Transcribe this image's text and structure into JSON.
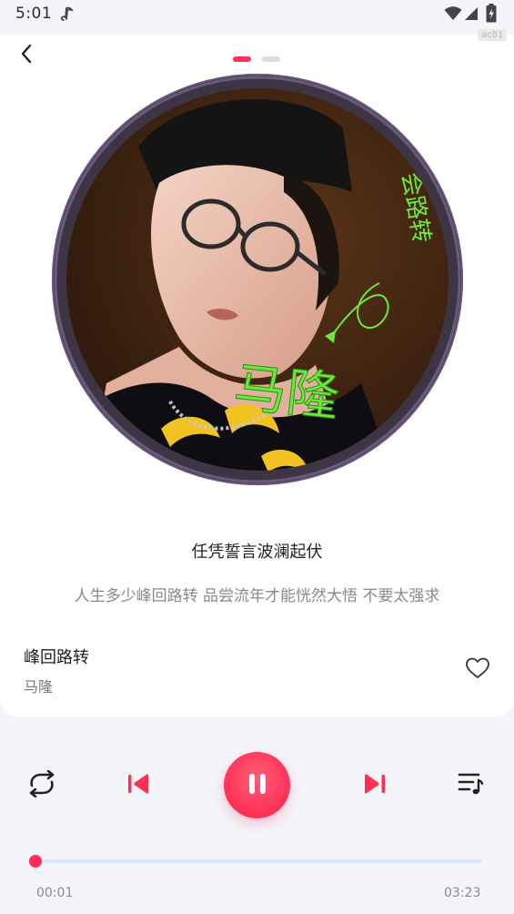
{
  "status_bar": {
    "time": "5:01",
    "app_icon": "music-note-icon",
    "wifi_icon": "wifi-icon",
    "signal_icon": "cell-signal-icon",
    "battery_icon": "battery-charging-icon"
  },
  "header": {
    "back_icon": "chevron-left-icon",
    "debug_badge": "ac81",
    "pages": 2,
    "active_page": 0
  },
  "album": {
    "cover_text": "马隆",
    "cover_text_secondary": "会路转"
  },
  "lyrics": {
    "current": "任凭誓言波澜起伏",
    "next": "人生多少峰回路转 品尝流年才能恍然大悟 不要太强求"
  },
  "song": {
    "title": "峰回路转",
    "artist": "马隆",
    "favorite_icon": "heart-outline-icon"
  },
  "controls": {
    "repeat_icon": "repeat-icon",
    "previous_icon": "skip-previous-icon",
    "play_pause_icon": "pause-icon",
    "next_icon": "skip-next-icon",
    "playlist_icon": "playlist-icon"
  },
  "progress": {
    "current_time": "00:01",
    "total_time": "03:23",
    "fraction": 0.005
  },
  "colors": {
    "accent": "#ff2f55",
    "background": "#f4f5f9",
    "card": "#ffffff",
    "track": "#dbe6f7",
    "cover_text": "#6bea3a"
  }
}
